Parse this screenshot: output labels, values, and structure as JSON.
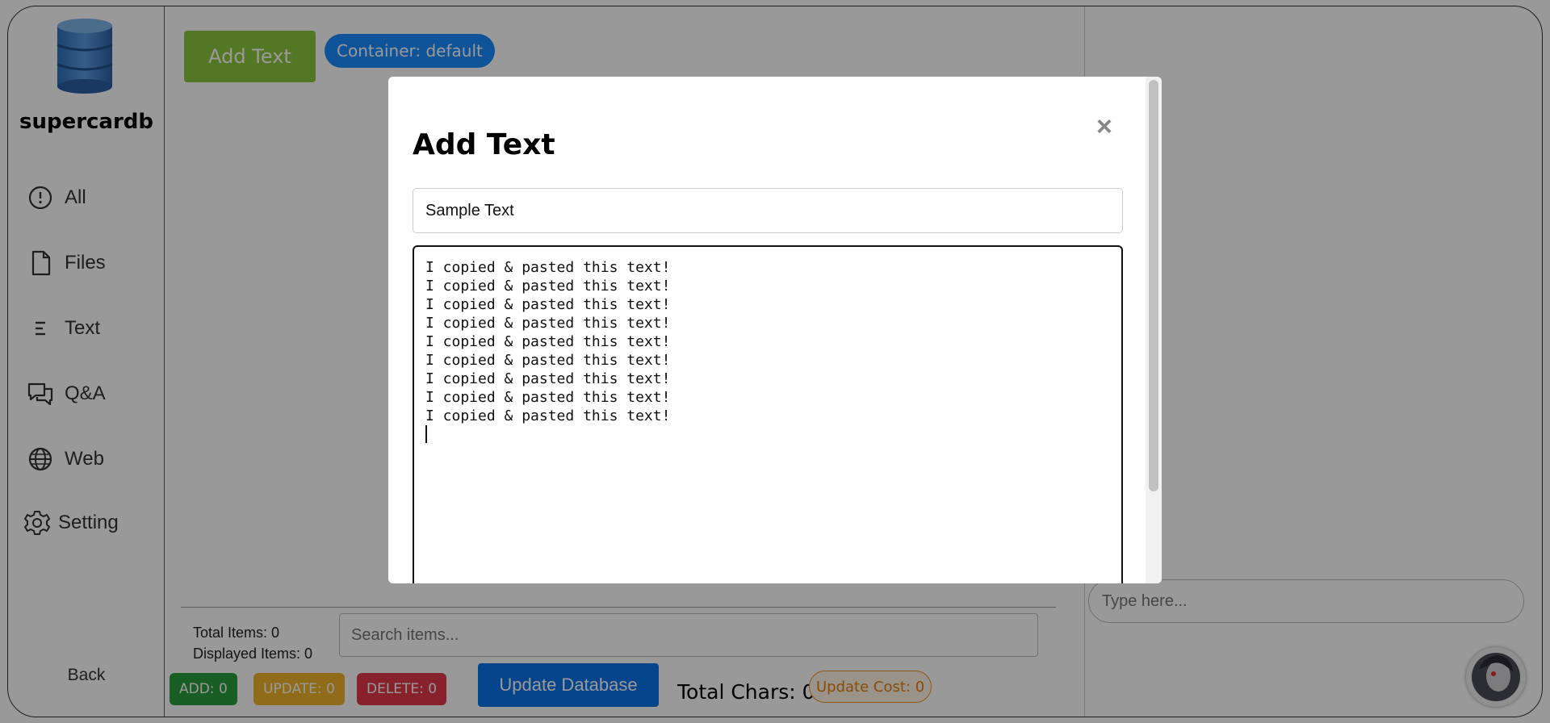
{
  "sidebar": {
    "brand": "supercardb",
    "items": [
      {
        "label": "All",
        "icon": "clock-icon"
      },
      {
        "label": "Files",
        "icon": "file-icon"
      },
      {
        "label": "Text",
        "icon": "text-lines-icon"
      },
      {
        "label": "Q&A",
        "icon": "chat-bubbles-icon"
      },
      {
        "label": "Web",
        "icon": "globe-icon"
      },
      {
        "label": "Setting",
        "icon": "gear-icon"
      }
    ],
    "back_label": "Back"
  },
  "toolbar": {
    "add_text_label": "Add Text",
    "container_label": "Container: default"
  },
  "footer": {
    "total_items": "Total Items: 0",
    "displayed_items": "Displayed Items: 0",
    "search_placeholder": "Search items...",
    "add_badge": "ADD: 0",
    "update_badge": "UPDATE: 0",
    "delete_badge": "DELETE: 0",
    "update_database_label": "Update Database",
    "total_chars": "Total Chars: 0",
    "update_cost": "Update Cost: 0"
  },
  "chat": {
    "placeholder": "Type here..."
  },
  "modal": {
    "title": "Add Text",
    "close_symbol": "×",
    "title_value": "Sample Text",
    "text_lines": [
      "I copied & pasted this text!",
      "I copied & pasted this text!",
      "I copied & pasted this text!",
      "I copied & pasted this text!",
      "I copied & pasted this text!",
      "I copied & pasted this text!",
      "I copied & pasted this text!",
      "I copied & pasted this text!",
      "I copied & pasted this text!"
    ]
  },
  "colors": {
    "add_text_button": "#8dc63f",
    "container_pill": "#1a8cff",
    "update_database": "#0b72ea",
    "badge_add": "#2a9d3f",
    "badge_update": "#f0b52c",
    "badge_delete": "#e13a4a",
    "cost_badge": "#e47d0c"
  }
}
